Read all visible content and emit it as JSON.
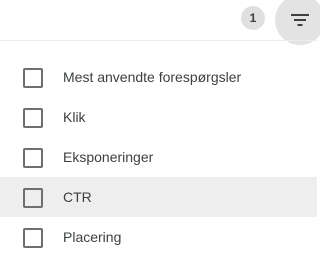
{
  "toolbar": {
    "active_filter_count": "1",
    "filter_icon": "filter-list-icon"
  },
  "menu": {
    "items": [
      {
        "label": "Mest anvendte forespørgsler",
        "checked": false
      },
      {
        "label": "Klik",
        "checked": false
      },
      {
        "label": "Eksponeringer",
        "checked": false
      },
      {
        "label": "CTR",
        "checked": false,
        "hovered": true
      },
      {
        "label": "Placering",
        "checked": false
      }
    ]
  },
  "colors": {
    "badge_bg": "#e0e0e0",
    "button_bg": "#e3e3e3",
    "hover_bg": "#eeeeee",
    "text": "#3c4043",
    "checkbox_border": "#6f6f6f"
  }
}
